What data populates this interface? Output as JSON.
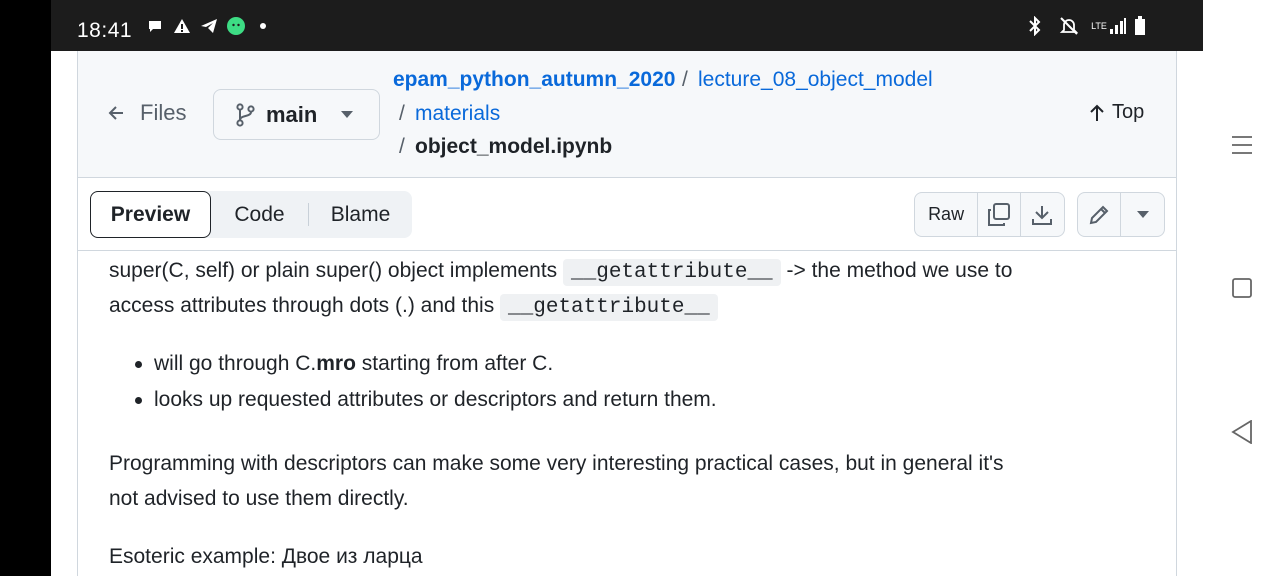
{
  "status": {
    "time": "18:41",
    "network": "LTE"
  },
  "header": {
    "back_label": "Files",
    "branch": "main",
    "breadcrumb": {
      "repo": "epam_python_autumn_2020",
      "folder1": "lecture_08_object_model",
      "folder2": "materials",
      "file": "object_model.ipynb",
      "separator": "/"
    },
    "top_label": "Top"
  },
  "toolbar": {
    "tabs": [
      "Preview",
      "Code",
      "Blame"
    ],
    "active_tab": "Preview",
    "raw_label": "Raw"
  },
  "content": {
    "p1_part1": "super(C, self) or plain super() object implements",
    "p1_code1": "__getattribute__",
    "p1_part2": "-> the method we use to",
    "p1_part3": "access attributes through dots (.) and this",
    "p1_code2": "__getattribute__",
    "bullet1_pre": "will go through C.",
    "bullet1_bold": "mro",
    "bullet1_post": "starting from after C.",
    "bullet2": "looks up requested attributes or descriptors and return them.",
    "p2_line1": "Programming with descriptors can make some very interesting practical cases, but in general it's",
    "p2_line2": "not advised to use them directly.",
    "p3": "Esoteric example: Двое из ларца"
  },
  "colors": {
    "link": "#0969da",
    "text": "#1f2328",
    "muted": "#57606a",
    "border": "#d0d7de",
    "header_bg": "#f6f8fa",
    "status_bar_bg": "#1c1c1c"
  },
  "icons": [
    "chat-bubble-icon",
    "warning-icon",
    "telegram-icon",
    "android-app-icon",
    "dot-icon",
    "bluetooth-icon",
    "muted-bell-icon",
    "signal-icon",
    "battery-icon",
    "arrow-left-icon",
    "branch-icon",
    "caret-down-icon",
    "arrow-up-icon",
    "copy-icon",
    "download-icon",
    "pencil-icon",
    "menu-lines-icon",
    "square-icon",
    "triangle-back-icon"
  ]
}
